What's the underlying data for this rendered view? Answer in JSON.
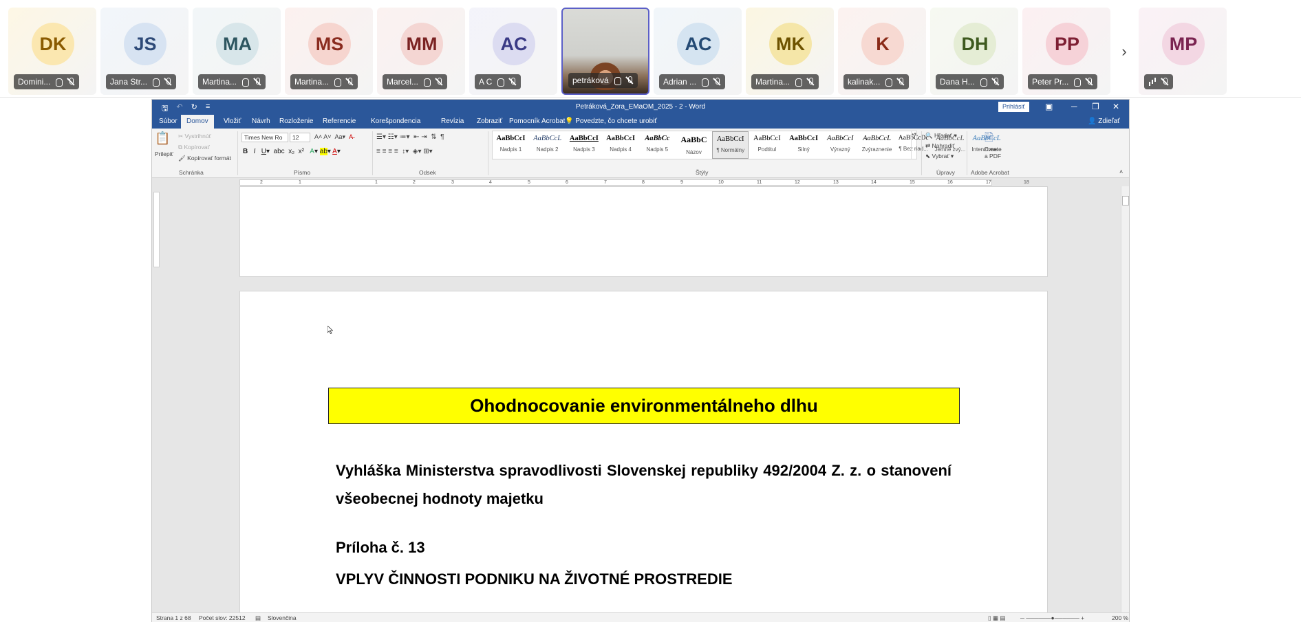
{
  "participants": [
    {
      "initials": "DK",
      "name": "Domini...",
      "bg": "#fbe7b0",
      "fg": "#8a5a00"
    },
    {
      "initials": "JS",
      "name": "Jana Str...",
      "bg": "#d7e3f2",
      "fg": "#2e4a78"
    },
    {
      "initials": "MA",
      "name": "Martina...",
      "bg": "#d8e6ea",
      "fg": "#2e5660"
    },
    {
      "initials": "MS",
      "name": "Martina...",
      "bg": "#f6d5cf",
      "fg": "#8a2b1f"
    },
    {
      "initials": "MM",
      "name": "Marcel...",
      "bg": "#f4d6d3",
      "fg": "#7a2222"
    },
    {
      "initials": "AC",
      "name": "A C",
      "bg": "#dcdcf1",
      "fg": "#3a3a85"
    },
    {
      "initials": "",
      "name": "petráková",
      "video": true
    },
    {
      "initials": "AC",
      "name": "Adrian ...",
      "bg": "#d5e4f1",
      "fg": "#244a74"
    },
    {
      "initials": "MK",
      "name": "Martina...",
      "bg": "#f5e6a8",
      "fg": "#6d5200"
    },
    {
      "initials": "K",
      "name": "kalinak...",
      "bg": "#f7d9d2",
      "fg": "#8a2a18"
    },
    {
      "initials": "DH",
      "name": "Dana H...",
      "bg": "#e5edd5",
      "fg": "#3e5a1f"
    },
    {
      "initials": "PP",
      "name": "Peter Pr...",
      "bg": "#f6d2d8",
      "fg": "#7e1f33"
    },
    {
      "initials": "MP",
      "name": "",
      "bg": "#f3d7e3",
      "fg": "#7a2350",
      "bars": true
    }
  ],
  "strip": {
    "next_glyph": "›"
  },
  "word": {
    "title": "Petráková_Zora_EMaOM_2025 - 2 - Word",
    "signin": "Prihlásiť",
    "share": "Zdieľať",
    "menu": [
      "Súbor",
      "Domov",
      "Vložiť",
      "Návrh",
      "Rozloženie",
      "Referencie",
      "Korešpondencia",
      "Revízia",
      "Zobraziť",
      "Pomocník",
      "Acrobat"
    ],
    "active_menu": "Domov",
    "tellme": "Povedzte, čo chcete urobiť",
    "clipboard": {
      "paste": "Prilepiť",
      "cut": "Vystrihnúť",
      "copy": "Kopírovať",
      "format": "Kopírovať formát",
      "group": "Schránka"
    },
    "font": {
      "name": "Times New Ro",
      "size": "12",
      "group": "Písmo"
    },
    "paragraph": {
      "group": "Odsek"
    },
    "styles": {
      "group": "Štýly",
      "items": [
        {
          "preview": "AaBbCcI",
          "label": "Nadpis 1"
        },
        {
          "preview": "AaBbCcL",
          "label": "Nadpis 2"
        },
        {
          "preview": "AaBbCcI",
          "label": "Nadpis 3"
        },
        {
          "preview": "AaBbCcI",
          "label": "Nadpis 4"
        },
        {
          "preview": "AaBbCc",
          "label": "Nadpis 5"
        },
        {
          "preview": "AaBbC",
          "label": "Názov"
        },
        {
          "preview": "AaBbCcI",
          "label": "¶ Normálny"
        },
        {
          "preview": "AaBbCcI",
          "label": "Podtitul"
        },
        {
          "preview": "AaBbCcI",
          "label": "Silný"
        },
        {
          "preview": "AaBbCcI",
          "label": "Výrazný"
        },
        {
          "preview": "AaBbCcL",
          "label": "Zvýraznenie"
        },
        {
          "preview": "AaBbCcDc",
          "label": "¶ Bez riad..."
        },
        {
          "preview": "AaBbCcL",
          "label": "Jemné zvý..."
        },
        {
          "preview": "AaBbCcL",
          "label": "Intenzívne..."
        }
      ]
    },
    "editing": {
      "find": "Hľadať",
      "replace": "Nahradiť",
      "select": "Vybrať",
      "group": "Úpravy"
    },
    "acrobat": {
      "create": "Create",
      "pdf": "a PDF",
      "group": "Adobe Acrobat"
    },
    "ruler_numbers": [
      "2",
      "1",
      "1",
      "2",
      "3",
      "4",
      "5",
      "6",
      "7",
      "8",
      "9",
      "10",
      "11",
      "12",
      "13",
      "14",
      "15",
      "16",
      "17",
      "18"
    ],
    "document": {
      "banner": "Ohodnocovanie environmentálneho dlhu",
      "paragraph": "Vyhláška Ministerstva spravodlivosti Slovenskej republiky 492/2004 Z. z. o stanovení všeobecnej hodnoty majetku",
      "annex": "Príloha č. 13",
      "heading": "VPLYV ČINNOSTI PODNIKU NA ŽIVOTNÉ PROSTREDIE"
    },
    "status": {
      "page": "Strana 1 z 68",
      "words": "Počet slov: 22512",
      "lang": "Slovenčina",
      "zoom": "200 %"
    }
  },
  "colors": {
    "word_blue": "#2b579a",
    "banner_yellow": "#ffff00",
    "active_border": "#5b5fc7"
  }
}
